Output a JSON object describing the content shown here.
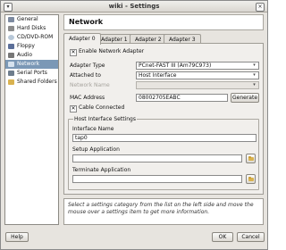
{
  "window": {
    "title": "wiki - Settings"
  },
  "sidebar": {
    "items": [
      {
        "label": "General"
      },
      {
        "label": "Hard Disks"
      },
      {
        "label": "CD/DVD-ROM"
      },
      {
        "label": "Floppy"
      },
      {
        "label": "Audio"
      },
      {
        "label": "Network",
        "selected": true
      },
      {
        "label": "Serial Ports"
      },
      {
        "label": "Shared Folders"
      }
    ]
  },
  "page": {
    "title": "Network"
  },
  "tabs": [
    {
      "label": "Adapter 0",
      "active": true
    },
    {
      "label": "Adapter 1"
    },
    {
      "label": "Adapter 2"
    },
    {
      "label": "Adapter 3"
    }
  ],
  "adapter": {
    "enable_label": "Enable Network Adapter",
    "enable_checked": "✕",
    "adapter_type_label": "Adapter Type",
    "adapter_type_value": "PCnet-FAST III (Am79C973)",
    "attached_to_label": "Attached to",
    "attached_to_value": "Host Interface",
    "network_name_label": "Network Name",
    "mac_label": "MAC Address",
    "mac_value": "08002705EABC",
    "generate_label": "Generate",
    "cable_label": "Cable Connected",
    "cable_checked": "✕"
  },
  "host_interface": {
    "group_title": "Host Interface Settings",
    "interface_name_label": "Interface Name",
    "interface_name_value": "tap0",
    "setup_app_label": "Setup Application",
    "setup_app_value": "",
    "terminate_app_label": "Terminate Application",
    "terminate_app_value": ""
  },
  "info": {
    "text": "Select a settings category from the list on the left side and move the mouse over a settings item to get more information."
  },
  "buttons": {
    "help": "Help",
    "ok": "OK",
    "cancel": "Cancel"
  },
  "icons": {
    "general": "gear-icon",
    "hard_disks": "hard-disk-icon",
    "cd_dvd": "cd-icon",
    "floppy": "floppy-icon",
    "audio": "speaker-icon",
    "network": "network-icon",
    "serial_ports": "serial-port-icon",
    "shared_folders": "folder-icon"
  }
}
